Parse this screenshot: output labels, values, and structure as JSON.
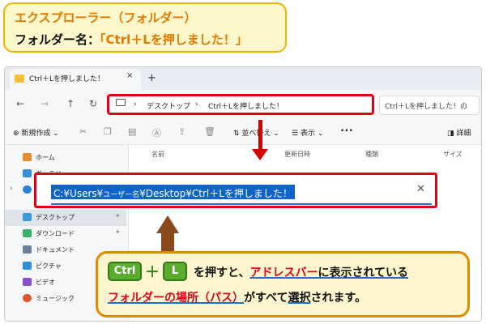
{
  "callout_top": {
    "line1": "エクスプローラー（フォルダー）",
    "line2_prefix": "フォルダー名：",
    "line2_name": "「Ctrl＋Lを押しました！」"
  },
  "window": {
    "tab_title": "Ctrl＋Lを押しました！",
    "tab_close": "×",
    "tab_new": "+",
    "nav": {
      "back": "←",
      "forward": "→",
      "up": "↑",
      "refresh": "↻"
    },
    "address_bar": {
      "separator1": "›",
      "crumb1": "デスクトップ",
      "separator2": "›",
      "crumb2": "Ctrl＋Lを押しました！"
    },
    "search_placeholder": "Ctrl＋Lを押しました！の",
    "toolbar": {
      "new_label": "新規作成",
      "sort_label": "並べ替え",
      "view_label": "表示",
      "more_label": "•••",
      "details_label": "詳細"
    },
    "sidebar": [
      {
        "label": "ホーム",
        "color": "#e98b2a"
      },
      {
        "label": "ギャラリー",
        "color": "#3a8fd9"
      },
      {
        "label": "",
        "color": "#2a7fd6"
      },
      {
        "label": "デスクトップ",
        "color": "#3a9ad9"
      },
      {
        "label": "ダウンロード",
        "color": "#3bb06a"
      },
      {
        "label": "ドキュメント",
        "color": "#6b7f99"
      },
      {
        "label": "ピクチャ",
        "color": "#2f8fd6"
      },
      {
        "label": "ビデオ",
        "color": "#8a4fd0"
      },
      {
        "label": "ミュージック",
        "color": "#e0522a"
      }
    ],
    "columns": [
      "名前",
      "更新日時",
      "種類",
      "サイズ"
    ]
  },
  "big_address": {
    "path_a": "C:¥Users¥",
    "path_user": "ユーザー名",
    "path_b": "¥Desktop¥Ctrl＋Lを押しました！",
    "clear": "✕"
  },
  "callout_bottom": {
    "key1": "Ctrl",
    "plus": "＋",
    "key2": "L",
    "line1_a": "を押すと、",
    "line1_b": "アドレスバー",
    "line1_c": "に表示されている",
    "line2_a": "フォルダーの場所（パス）",
    "line2_b": "がすべて",
    "line2_c": "選択",
    "line2_d": "されます。"
  },
  "colors": {
    "accent_red": "#e00012",
    "selection_blue": "#0f63c9",
    "callout_orange": "#e08a00"
  }
}
